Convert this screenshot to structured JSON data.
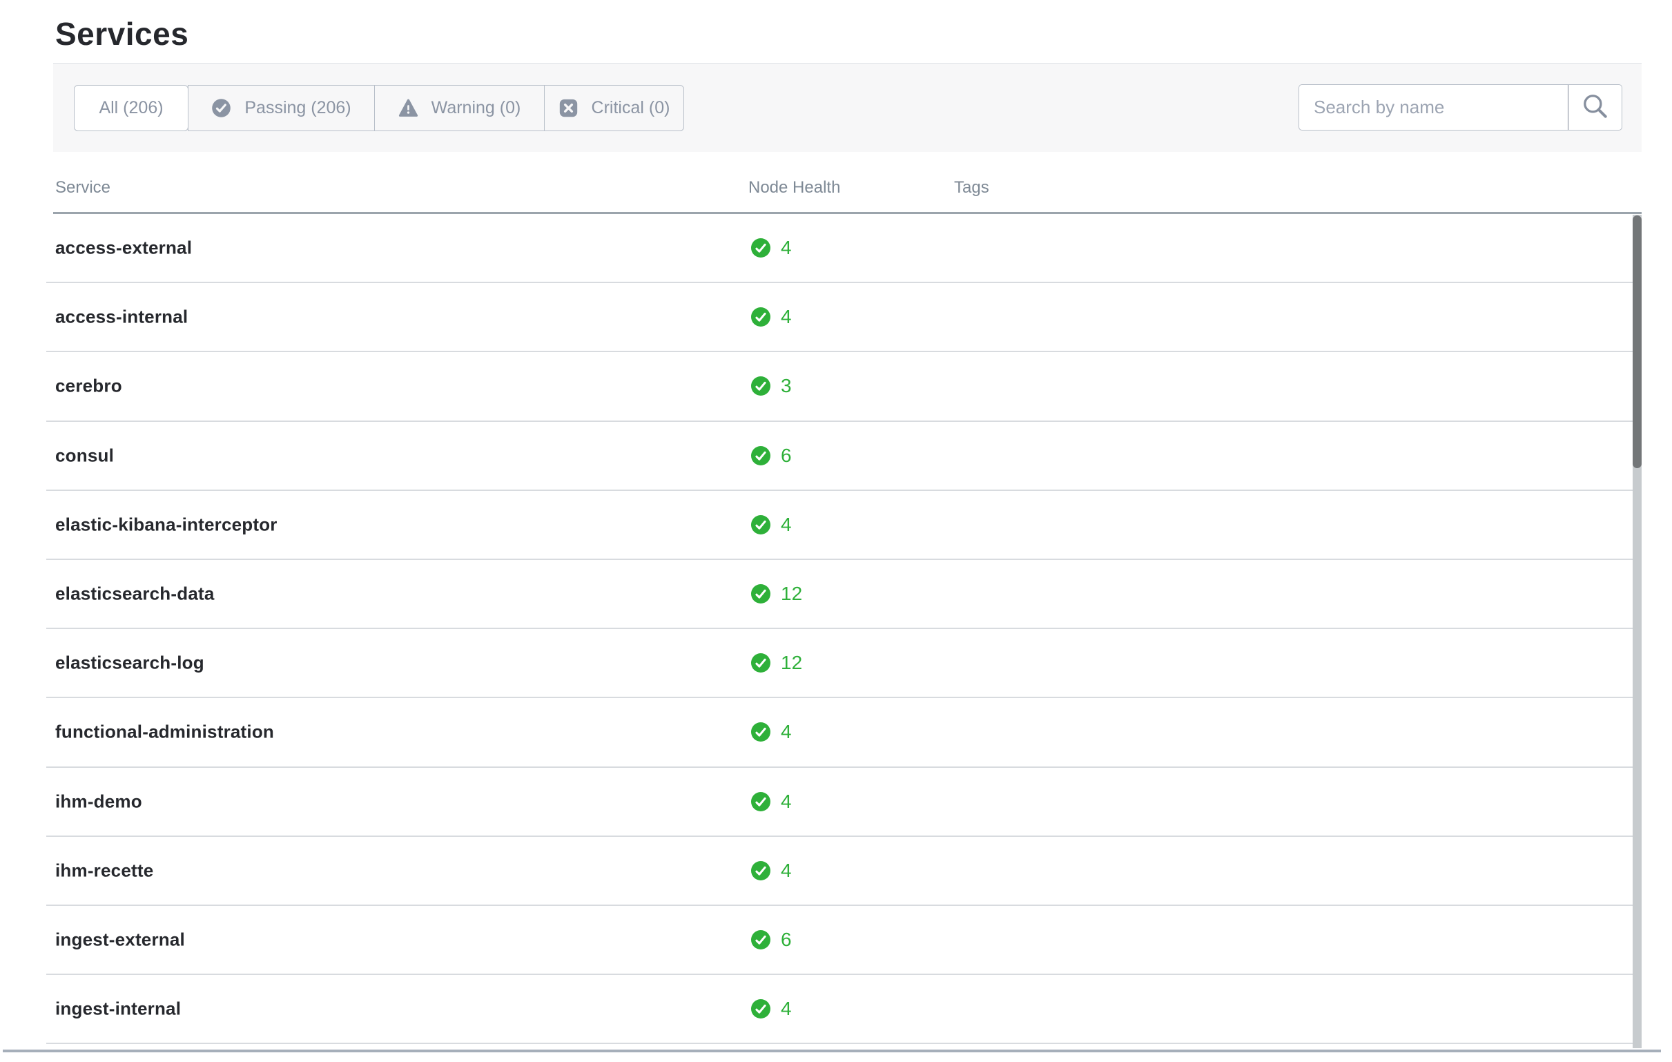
{
  "page": {
    "title": "Services"
  },
  "toolbar": {
    "tabs": [
      {
        "label": "All (206)",
        "selected": true
      },
      {
        "label": "Passing (206)",
        "icon": "check-circle"
      },
      {
        "label": "Warning (0)",
        "icon": "warning-triangle"
      },
      {
        "label": "Critical (0)",
        "icon": "critical-square"
      }
    ],
    "search": {
      "placeholder": "Search by name",
      "icon": "search-magnifier"
    }
  },
  "table": {
    "columns": {
      "service": "Service",
      "node_health": "Node Health",
      "tags": "Tags"
    },
    "rows": [
      {
        "service": "access-external",
        "node_health": "4",
        "health_status": "passing",
        "tags": ""
      },
      {
        "service": "access-internal",
        "node_health": "4",
        "health_status": "passing",
        "tags": ""
      },
      {
        "service": "cerebro",
        "node_health": "3",
        "health_status": "passing",
        "tags": ""
      },
      {
        "service": "consul",
        "node_health": "6",
        "health_status": "passing",
        "tags": ""
      },
      {
        "service": "elastic-kibana-interceptor",
        "node_health": "4",
        "health_status": "passing",
        "tags": ""
      },
      {
        "service": "elasticsearch-data",
        "node_health": "12",
        "health_status": "passing",
        "tags": ""
      },
      {
        "service": "elasticsearch-log",
        "node_health": "12",
        "health_status": "passing",
        "tags": ""
      },
      {
        "service": "functional-administration",
        "node_health": "4",
        "health_status": "passing",
        "tags": ""
      },
      {
        "service": "ihm-demo",
        "node_health": "4",
        "health_status": "passing",
        "tags": ""
      },
      {
        "service": "ihm-recette",
        "node_health": "4",
        "health_status": "passing",
        "tags": ""
      },
      {
        "service": "ingest-external",
        "node_health": "6",
        "health_status": "passing",
        "tags": ""
      },
      {
        "service": "ingest-internal",
        "node_health": "4",
        "health_status": "passing",
        "tags": ""
      }
    ]
  },
  "colors": {
    "passing_green": "#2eb039",
    "tab_gray": "#8b94a3",
    "toolbar_bg": "#f7f7f8"
  }
}
